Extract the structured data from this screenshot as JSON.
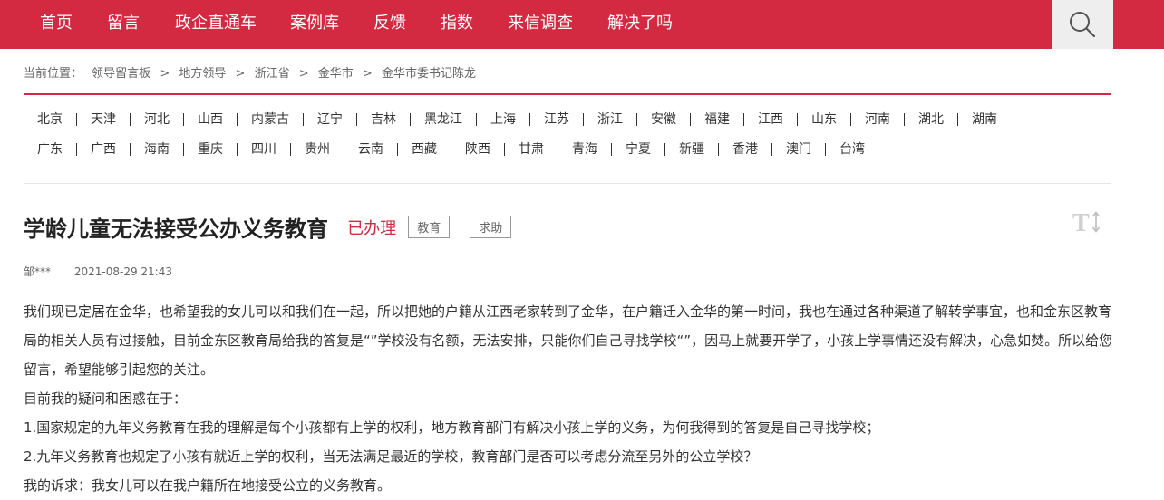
{
  "nav": {
    "items": [
      "首页",
      "留言",
      "政企直通车",
      "案例库",
      "反馈",
      "指数",
      "来信调查",
      "解决了吗"
    ],
    "search_icon": "search-icon"
  },
  "breadcrumb": {
    "prefix": "当前位置：",
    "items": [
      "领导留言板",
      "地方领导",
      "浙江省",
      "金华市",
      "金华市委书记陈龙"
    ],
    "separator": ">"
  },
  "provinces": {
    "row1": [
      "北京",
      "天津",
      "河北",
      "山西",
      "内蒙古",
      "辽宁",
      "吉林",
      "黑龙江",
      "上海",
      "江苏",
      "浙江",
      "安徽",
      "福建",
      "江西",
      "山东",
      "河南",
      "湖北",
      "湖南"
    ],
    "row2": [
      "广东",
      "广西",
      "海南",
      "重庆",
      "四川",
      "贵州",
      "云南",
      "西藏",
      "陕西",
      "甘肃",
      "青海",
      "宁夏",
      "新疆",
      "香港",
      "澳门",
      "台湾"
    ]
  },
  "message": {
    "title": "学龄儿童无法接受公办义务教育",
    "status": "已办理",
    "tags": [
      "教育",
      "求助"
    ],
    "author": "邹***",
    "date": "2021-08-29 21:43",
    "paragraphs": [
      "我们现已定居在金华，也希望我的女儿可以和我们在一起，所以把她的户籍从江西老家转到了金华，在户籍迁入金华的第一时间，我也在通过各种渠道了解转学事宜，也和金东区教育局的相关人员有过接触，目前金东区教育局给我的答复是“”学校没有名额，无法安排，只能你们自己寻找学校“”，因马上就要开学了，小孩上学事情还没有解决，心急如焚。所以给您留言，希望能够引起您的关注。",
      "目前我的疑问和困惑在于：",
      "1.国家规定的九年义务教育在我的理解是每个小孩都有上学的权利，地方教育部门有解决小孩上学的义务，为何我得到的答复是自己寻找学校；",
      "2.九年义务教育也规定了小孩有就近上学的权利，当无法满足最近的学校，教育部门是否可以考虑分流至另外的公立学校？",
      "我的诉求：我女儿可以在我户籍所在地接受公立的义务教育。"
    ]
  },
  "font_toggle": {
    "icon": "font-size-icon",
    "glyph": "T"
  },
  "colors": {
    "brand_red": "#d32a41",
    "search_bg": "#eeeeee"
  }
}
